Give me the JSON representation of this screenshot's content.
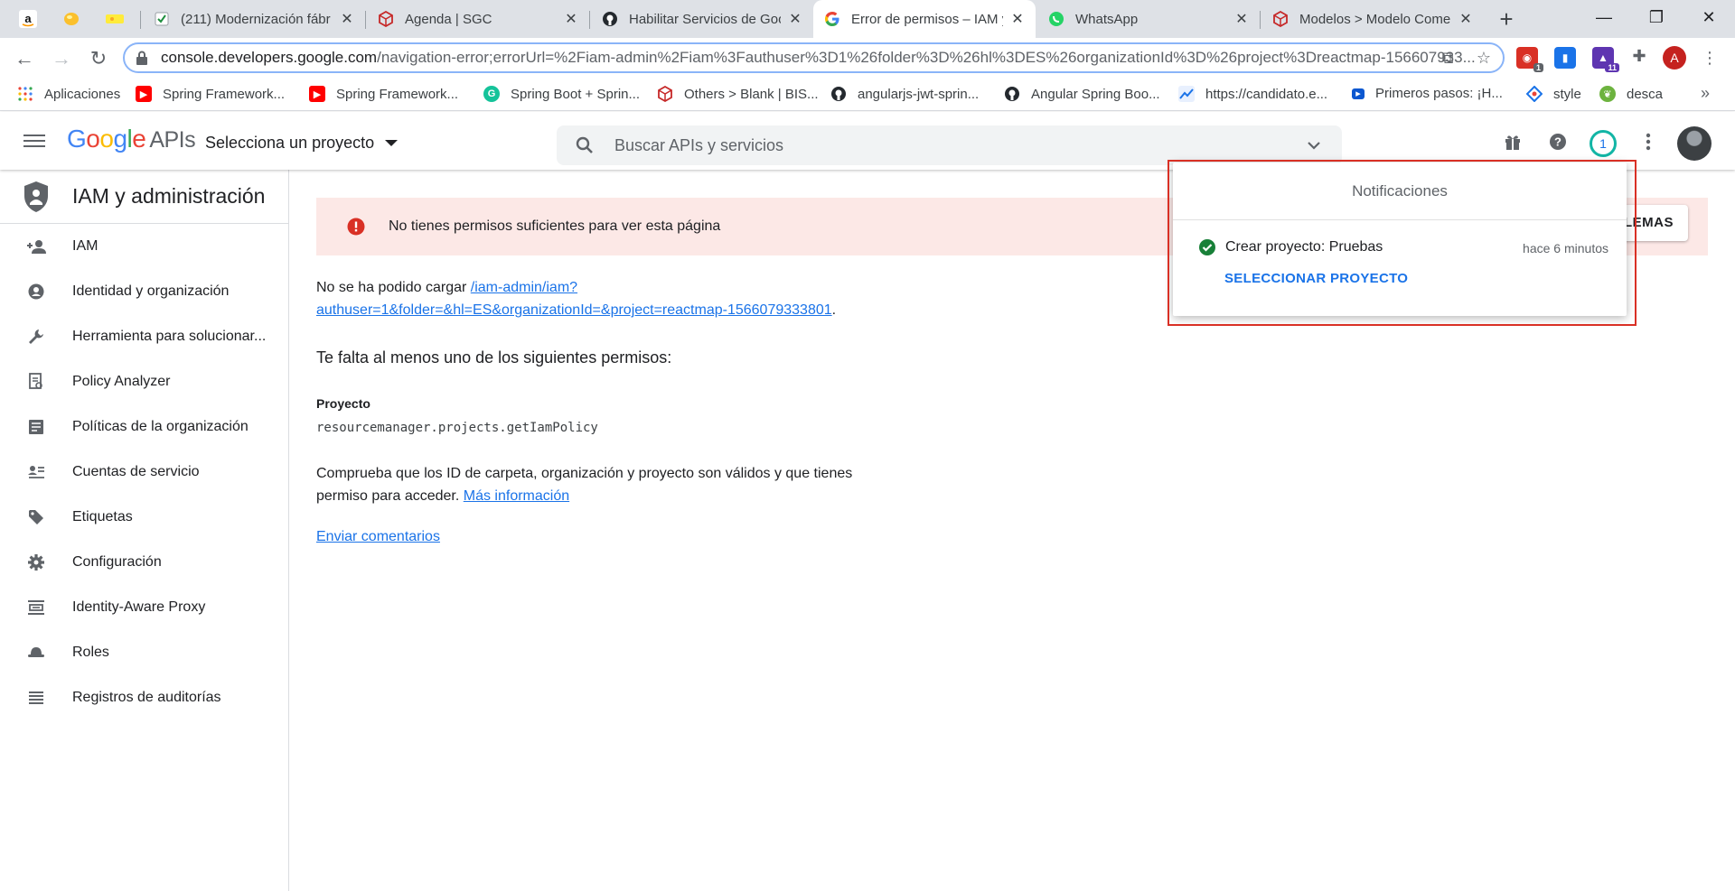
{
  "browser": {
    "tabs": [
      {
        "title": "(211) Modernización fábr",
        "favicon": "notes-check-icon"
      },
      {
        "title": "Agenda | SGC",
        "favicon": "sgc-cube-icon"
      },
      {
        "title": "Habilitar Servicios de Goo",
        "favicon": "github-icon"
      },
      {
        "title": "Error de permisos – IAM y",
        "favicon": "google-icon",
        "active": true
      },
      {
        "title": "WhatsApp",
        "favicon": "whatsapp-icon"
      },
      {
        "title": "Modelos > Modelo Come",
        "favicon": "sgc-cube-icon"
      }
    ],
    "window_controls": {
      "minimize": "—",
      "restore": "❐",
      "close": "✕"
    },
    "url": {
      "host": "console.developers.google.com",
      "path": "/navigation-error;errorUrl=%2Fiam-admin%2Fiam%3Fauthuser%3D1%26folder%3D%26hl%3DES%26organizationId%3D%26project%3Dreactmap-156607933..."
    },
    "profile_initial": "A",
    "bookmarks": [
      {
        "label": "Aplicaciones",
        "icon": "apps-grid-icon"
      },
      {
        "label": "Spring Framework...",
        "icon": "youtube-icon"
      },
      {
        "label": "Spring Framework...",
        "icon": "youtube-icon"
      },
      {
        "label": "Spring Boot + Sprin...",
        "icon": "grammarly-icon"
      },
      {
        "label": "Others > Blank | BIS...",
        "icon": "sgc-cube-icon"
      },
      {
        "label": "angularjs-jwt-sprin...",
        "icon": "github-icon"
      },
      {
        "label": "Angular Spring Boo...",
        "icon": "github-icon"
      },
      {
        "label": "https://candidato.e...",
        "icon": "chart-icon"
      },
      {
        "label": "Primeros pasos: ¡H...",
        "icon": "play-icon"
      },
      {
        "label": "style",
        "icon": "diamond-icon"
      },
      {
        "label": "desca",
        "icon": "leaf-icon"
      }
    ],
    "extension_badges": {
      "red_ext": "1",
      "purple_ext": "11"
    },
    "bookmarks_more": "»"
  },
  "console": {
    "logo": {
      "google": "Google",
      "apis": "APIs"
    },
    "project_selector": "Selecciona un proyecto",
    "search_placeholder": "Buscar APIs y servicios",
    "notification_count": "1"
  },
  "sidebar": {
    "title": "IAM y administración",
    "items": [
      {
        "label": "IAM",
        "icon": "person-add-icon"
      },
      {
        "label": "Identidad y organización",
        "icon": "account-circle-icon"
      },
      {
        "label": "Herramienta para solucionar...",
        "icon": "wrench-icon"
      },
      {
        "label": "Policy Analyzer",
        "icon": "policy-doc-icon"
      },
      {
        "label": "Políticas de la organización",
        "icon": "article-icon"
      },
      {
        "label": "Cuentas de servicio",
        "icon": "service-account-icon"
      },
      {
        "label": "Etiquetas",
        "icon": "tag-icon"
      },
      {
        "label": "Configuración",
        "icon": "gear-icon"
      },
      {
        "label": "Identity-Aware Proxy",
        "icon": "proxy-icon"
      },
      {
        "label": "Roles",
        "icon": "hat-icon"
      },
      {
        "label": "Registros de auditorías",
        "icon": "list-lines-icon"
      }
    ]
  },
  "alert": {
    "message": "No tienes permisos suficientes para ver esta página",
    "button_label": "LEMAS"
  },
  "main": {
    "load_error_prefix": "No se ha podido cargar ",
    "load_error_link_1": "/iam-admin/iam?",
    "load_error_link_2": "authuser=1&folder=&hl=ES&organizationId=&project=reactmap-1566079333801",
    "load_error_suffix": ".",
    "missing_permissions": "Te falta al menos uno de los siguientes permisos:",
    "permission_group": "Proyecto",
    "permission": "resourcemanager.projects.getIamPolicy",
    "check_text": "Comprueba que los ID de carpeta, organización y proyecto son válidos y que tienes permiso para acceder. ",
    "more_info": "Más información",
    "feedback": "Enviar comentarios"
  },
  "notifications": {
    "title": "Notificaciones",
    "items": [
      {
        "text": "Crear proyecto: Pruebas",
        "time": "hace 6 minutos",
        "action": "SELECCIONAR PROYECTO",
        "status": "success"
      }
    ]
  },
  "colors": {
    "accent": "#1a73e8",
    "alert_bg": "#fce8e6",
    "error_red": "#d93025",
    "success_green": "#188038"
  }
}
